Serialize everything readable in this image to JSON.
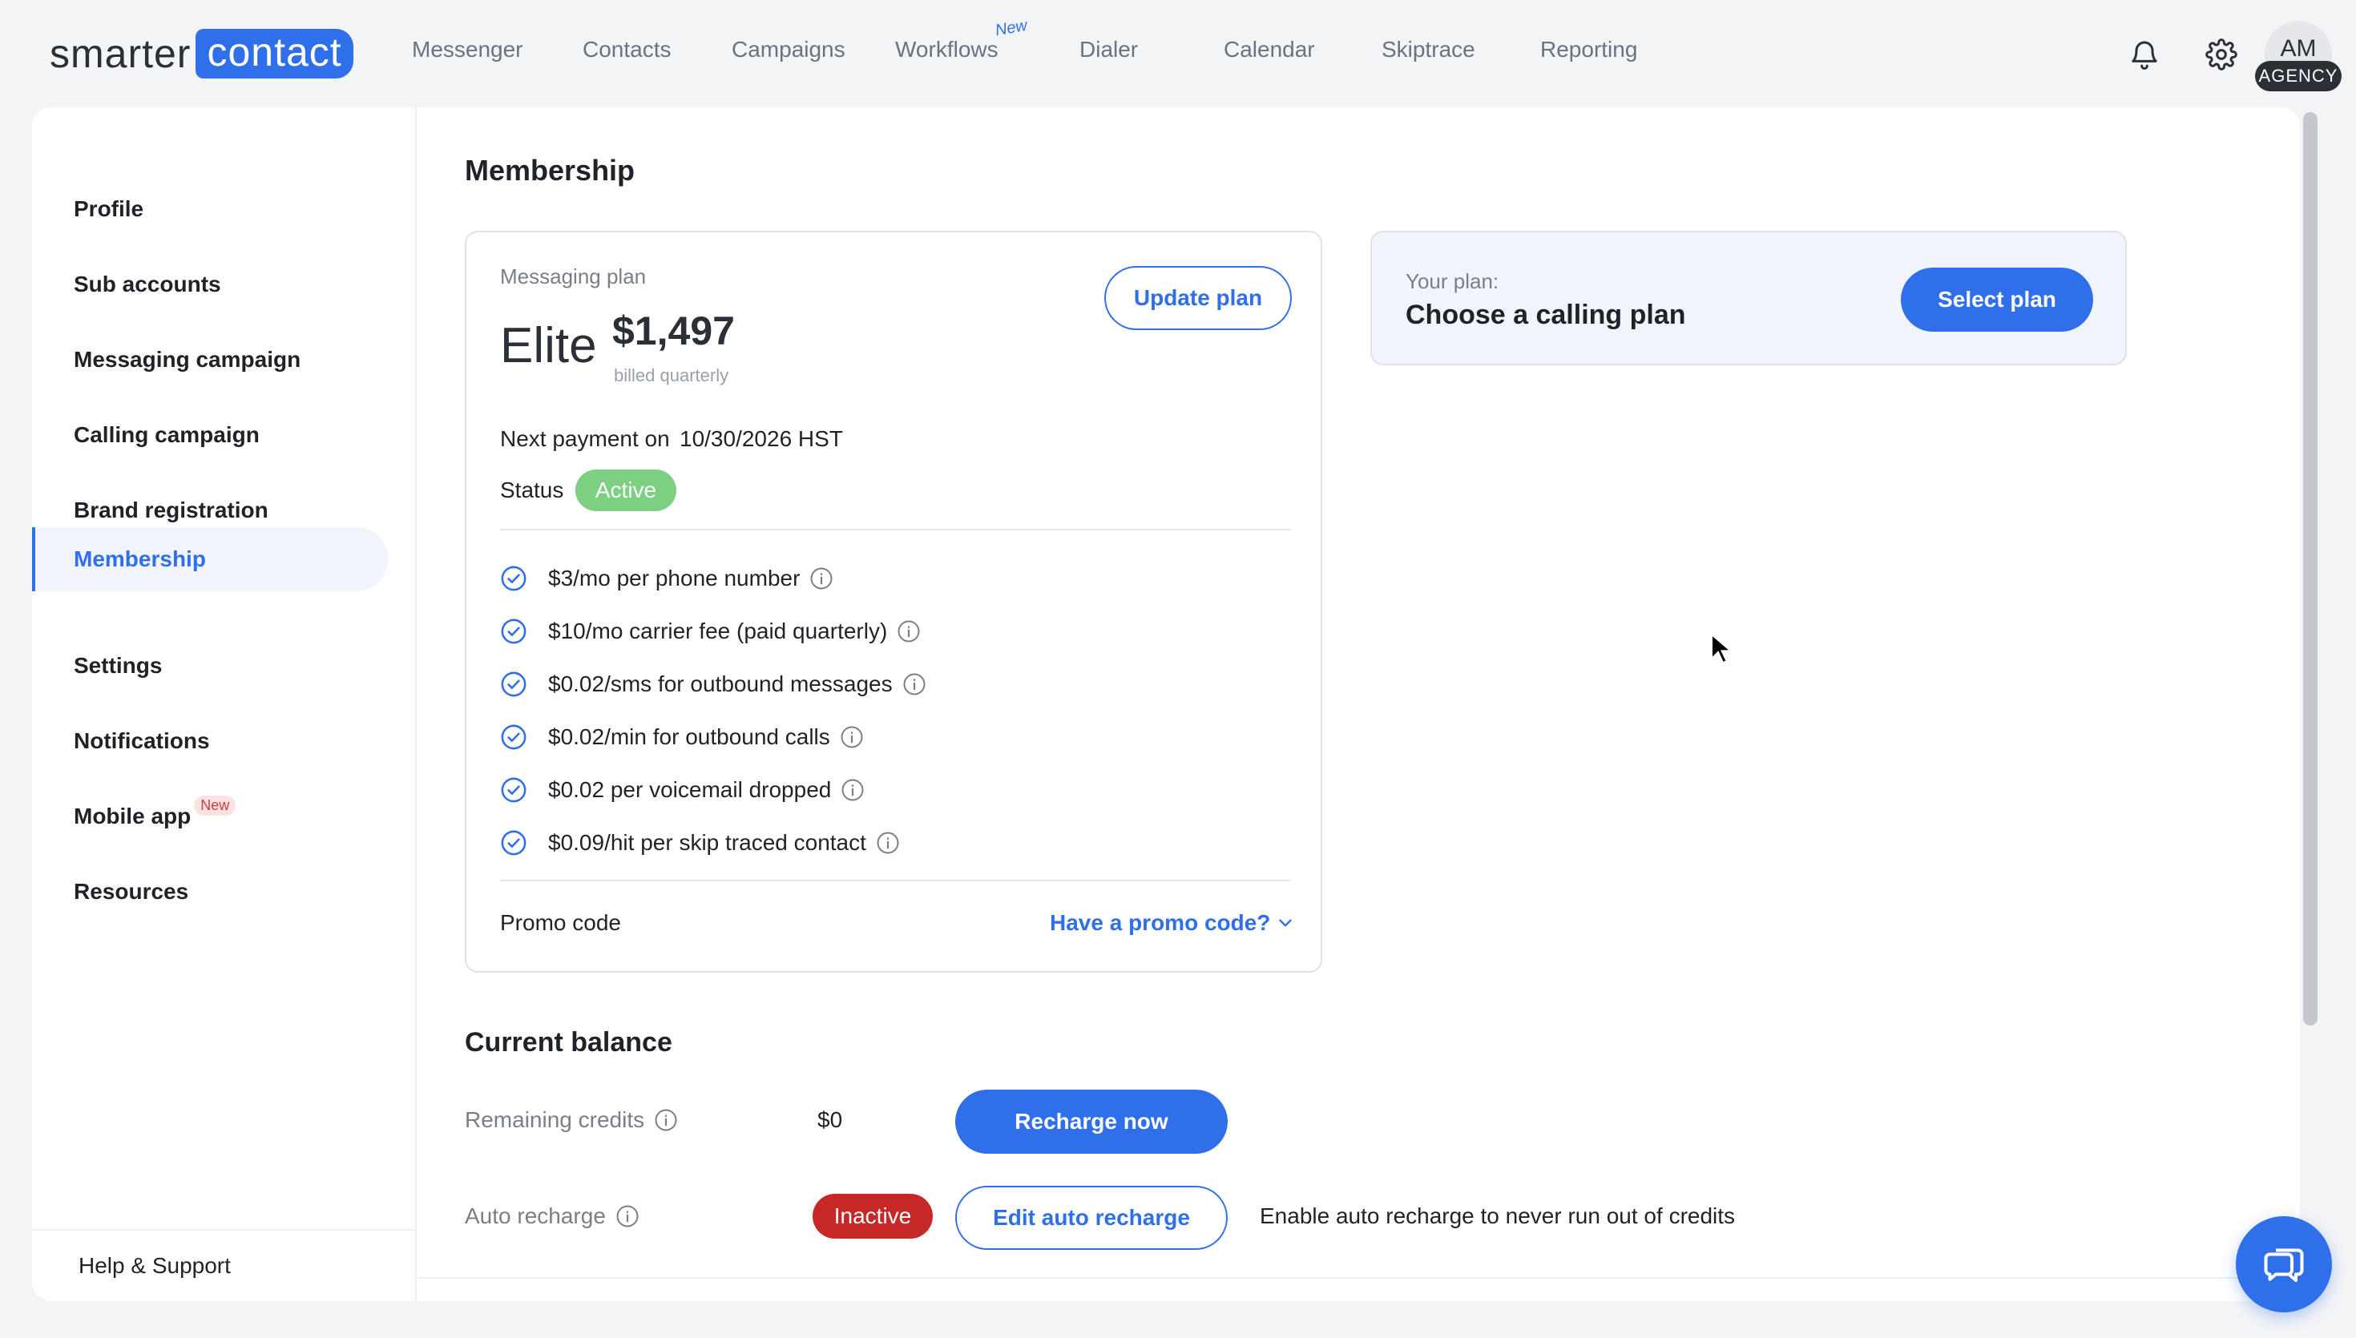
{
  "logo": {
    "part1": "smarter",
    "part2": "contact"
  },
  "nav": {
    "items": [
      "Messenger",
      "Contacts",
      "Campaigns",
      "Workflows",
      "Dialer",
      "Calendar",
      "Skiptrace",
      "Reporting"
    ],
    "workflows_badge": "New"
  },
  "user": {
    "initials": "AM",
    "role_badge": "AGENCY"
  },
  "sidebar": {
    "items": [
      "Profile",
      "Sub accounts",
      "Messaging campaign",
      "Calling campaign",
      "Brand registration",
      "Membership",
      "Settings",
      "Notifications",
      "Mobile app",
      "Resources"
    ],
    "mobile_badge": "New",
    "active": "Membership",
    "help": "Help & Support"
  },
  "page": {
    "title": "Membership"
  },
  "messaging_plan": {
    "label": "Messaging plan",
    "name": "Elite",
    "price": "$1,497",
    "billing": "billed quarterly",
    "update_button": "Update plan",
    "next_payment_label": "Next payment on",
    "next_payment_date": "10/30/2026 HST",
    "status_label": "Status",
    "status_value": "Active",
    "features": [
      "$3/mo per phone number",
      "$10/mo carrier fee (paid quarterly)",
      "$0.02/sms for outbound messages",
      "$0.02/min for outbound calls",
      "$0.02 per voicemail dropped",
      "$0.09/hit per skip traced contact"
    ],
    "promo_label": "Promo code",
    "promo_link": "Have a promo code?"
  },
  "calling_plan": {
    "label": "Your plan:",
    "title": "Choose a calling plan",
    "select_button": "Select plan"
  },
  "balance": {
    "title": "Current balance",
    "remaining_label": "Remaining credits",
    "remaining_value": "$0",
    "recharge_button": "Recharge now",
    "auto_label": "Auto recharge",
    "auto_status": "Inactive",
    "edit_button": "Edit auto recharge",
    "auto_hint": "Enable auto recharge to never run out of credits"
  },
  "colors": {
    "accent": "#2f6fe9",
    "active_pill": "#7dd082",
    "inactive_pill": "#c62828"
  }
}
